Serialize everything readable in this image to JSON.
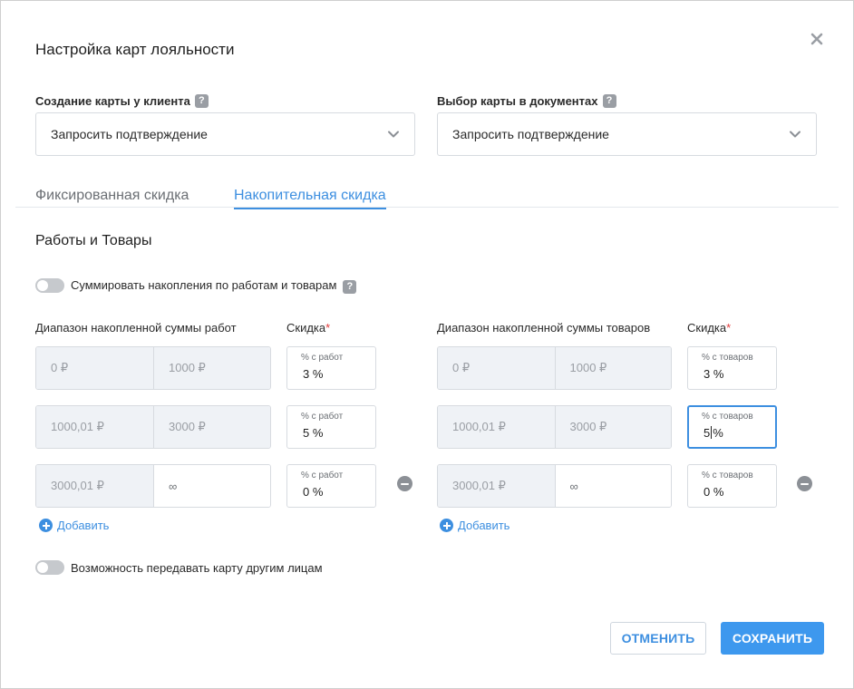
{
  "dialog": {
    "title": "Настройка карт лояльности",
    "close_icon": "close-icon"
  },
  "card_creation": {
    "label": "Создание карты у клиента",
    "value": "Запросить подтверждение"
  },
  "card_selection": {
    "label": "Выбор карты в документах",
    "value": "Запросить подтверждение"
  },
  "tabs": [
    {
      "label": "Фиксированная скидка",
      "active": false
    },
    {
      "label": "Накопительная скидка",
      "active": true
    }
  ],
  "section_title": "Работы и Товары",
  "sum_toggle": {
    "label": "Суммировать накопления по работам и товарам",
    "on": false
  },
  "works": {
    "range_header": "Диапазон накопленной суммы работ",
    "discount_header": "Скидка",
    "required_mark": "*",
    "percent_placeholder": "% с работ",
    "rows": [
      {
        "from": "0 ₽",
        "to": "1000 ₽",
        "discount": "3",
        "unit": "%"
      },
      {
        "from": "1000,01 ₽",
        "to": "3000 ₽",
        "discount": "5",
        "unit": "%"
      },
      {
        "from": "3000,01 ₽",
        "to": "∞",
        "discount": "0",
        "unit": "%"
      }
    ],
    "add_label": "Добавить"
  },
  "goods": {
    "range_header": "Диапазон накопленной суммы товаров",
    "discount_header": "Скидка",
    "required_mark": "*",
    "percent_placeholder": "% с товаров",
    "rows": [
      {
        "from": "0 ₽",
        "to": "1000 ₽",
        "discount": "3",
        "unit": "%"
      },
      {
        "from": "1000,01 ₽",
        "to": "3000 ₽",
        "discount": "5",
        "unit": "%"
      },
      {
        "from": "3000,01 ₽",
        "to": "∞",
        "discount": "0",
        "unit": "%"
      }
    ],
    "add_label": "Добавить"
  },
  "transfer_toggle": {
    "label": "Возможность передавать карту другим лицам",
    "on": false
  },
  "buttons": {
    "cancel": "ОТМЕНИТЬ",
    "save": "СОХРАНИТЬ"
  },
  "colors": {
    "accent": "#3d8fe0",
    "required": "#e23b3b",
    "disabled_bg": "#eff2f6"
  }
}
